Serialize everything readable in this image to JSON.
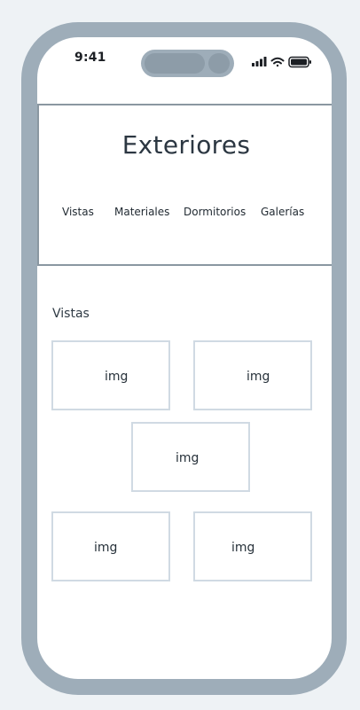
{
  "status_bar": {
    "time": "9:41",
    "icons": [
      "cellular-signal-icon",
      "wifi-icon",
      "battery-icon"
    ]
  },
  "header": {
    "title": "Exteriores",
    "nav": [
      "Vistas",
      "Materiales",
      "Dormitorios",
      "Galerías"
    ]
  },
  "section": {
    "label": "Vistas",
    "images": [
      "img",
      "img",
      "img",
      "img",
      "img"
    ]
  },
  "colors": {
    "frame": "#9eadb9",
    "border": "#8a97a1",
    "placeholder_border": "#d0dae3"
  }
}
